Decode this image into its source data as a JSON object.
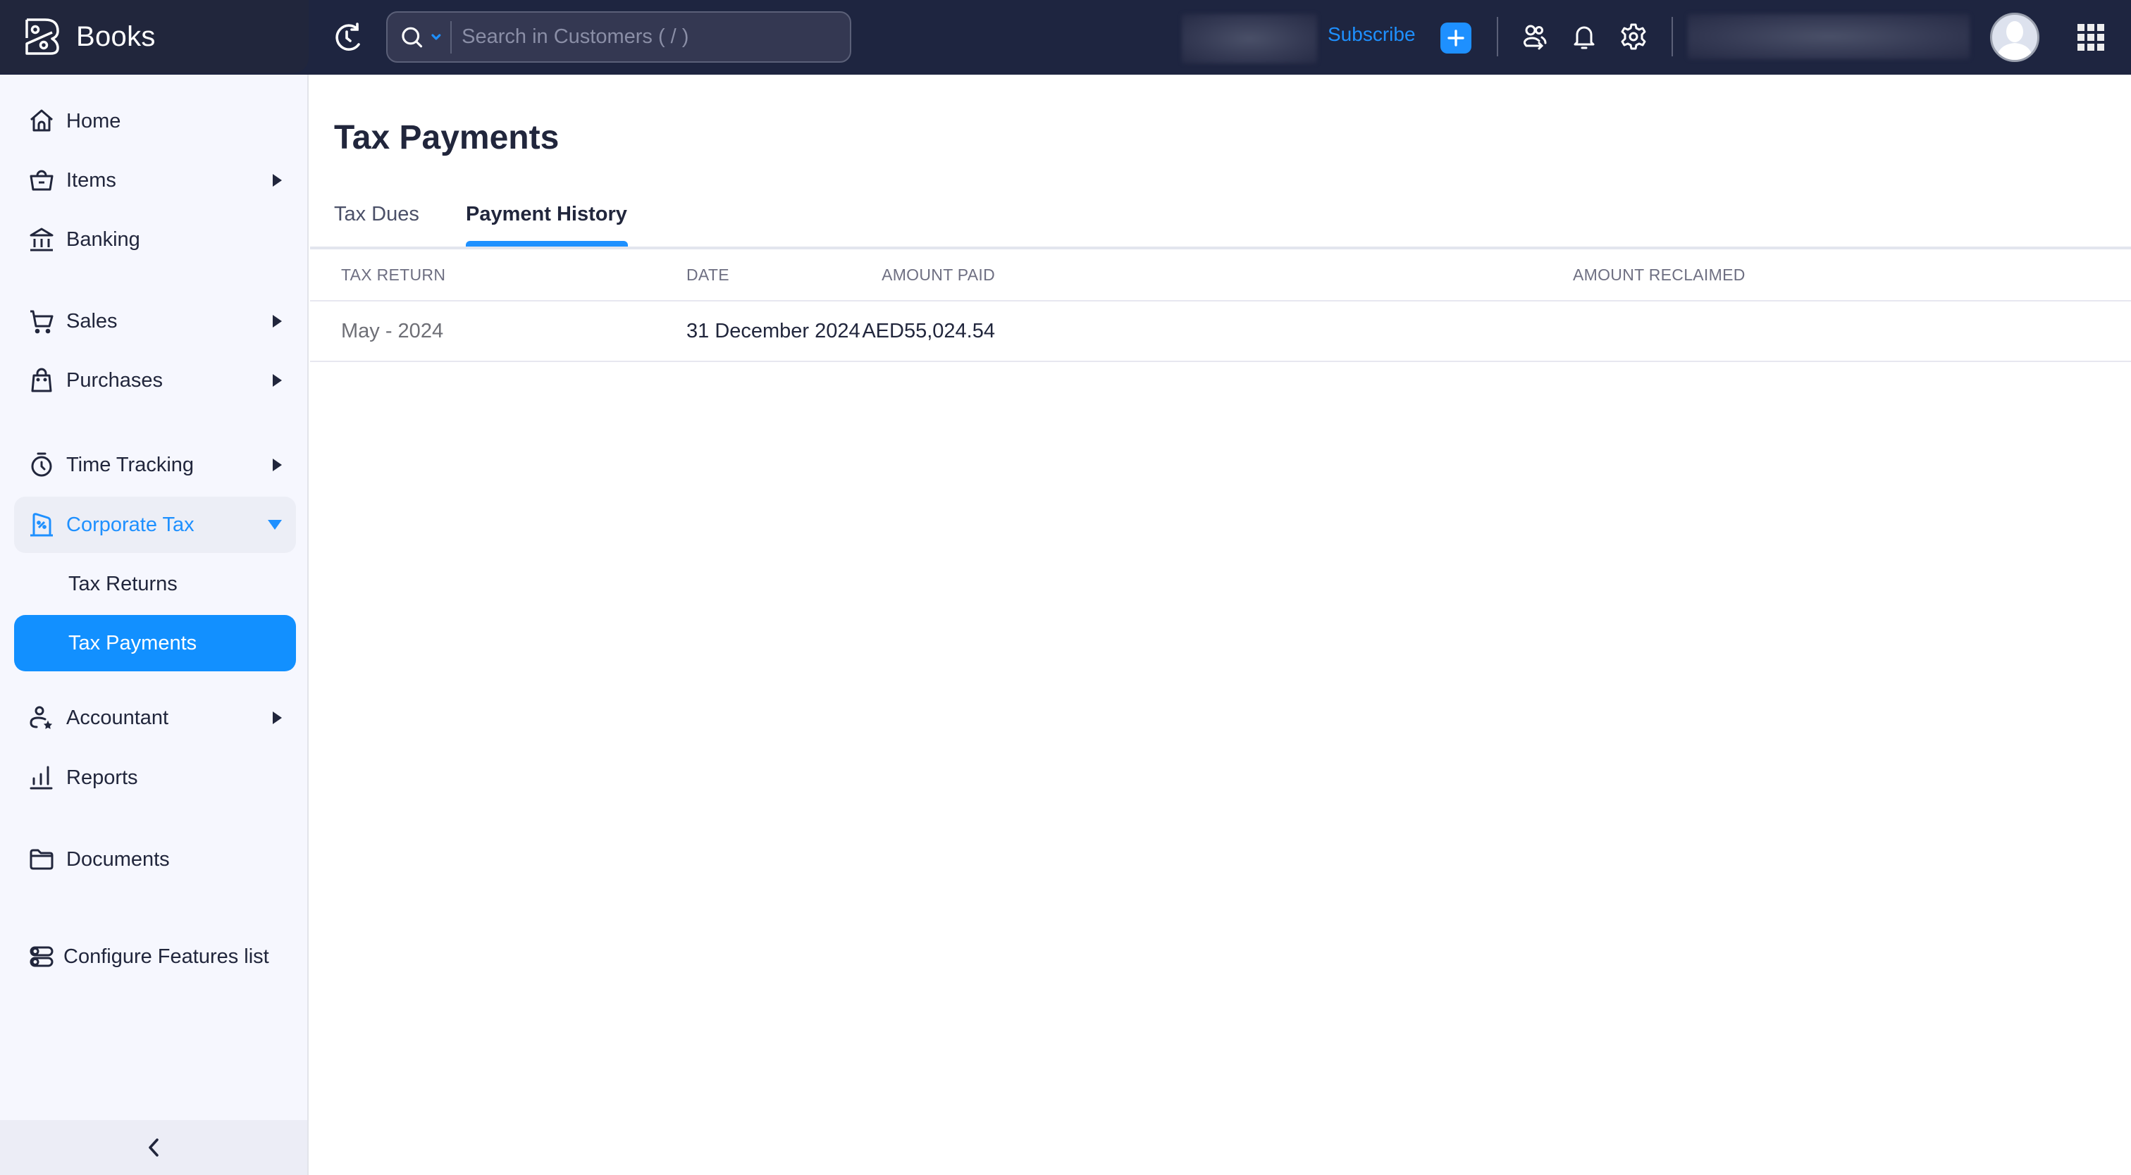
{
  "app": {
    "name": "Books",
    "logo_icon": "books-logo-icon"
  },
  "topbar": {
    "recent_icon": "history-clock-icon",
    "search": {
      "icon": "search-icon",
      "placeholder": "Search in Customers ( / )",
      "value": ""
    },
    "subscribe_label": "Subscribe",
    "add_icon": "plus-icon",
    "icons": [
      "refer-users-icon",
      "bell-icon",
      "gear-icon"
    ],
    "apps_icon": "apps-grid-icon"
  },
  "sidebar": {
    "items": [
      {
        "label": "Home",
        "icon": "home-icon",
        "has_submenu": false
      },
      {
        "label": "Items",
        "icon": "basket-icon",
        "has_submenu": true
      },
      {
        "label": "Banking",
        "icon": "bank-icon",
        "has_submenu": false
      },
      {
        "label": "Sales",
        "icon": "cart-icon",
        "has_submenu": true
      },
      {
        "label": "Purchases",
        "icon": "shopping-bag-icon",
        "has_submenu": true
      },
      {
        "label": "Time Tracking",
        "icon": "stopwatch-icon",
        "has_submenu": true
      },
      {
        "label": "Corporate Tax",
        "icon": "tax-document-icon",
        "has_submenu": true,
        "expanded": true
      },
      {
        "label": "Accountant",
        "icon": "accountant-icon",
        "has_submenu": true
      },
      {
        "label": "Reports",
        "icon": "bar-chart-icon",
        "has_submenu": false
      },
      {
        "label": "Documents",
        "icon": "folder-icon",
        "has_submenu": false
      },
      {
        "label": "Configure Features list",
        "icon": "toggles-icon",
        "has_submenu": false
      }
    ],
    "corporate_tax_subitems": [
      {
        "label": "Tax Returns",
        "active": false
      },
      {
        "label": "Tax Payments",
        "active": true
      }
    ],
    "collapse_icon": "chevron-left-icon"
  },
  "main": {
    "title": "Tax Payments",
    "tabs": [
      {
        "label": "Tax Dues",
        "active": false
      },
      {
        "label": "Payment History",
        "active": true
      }
    ],
    "table": {
      "columns": [
        "TAX RETURN",
        "DATE",
        "AMOUNT PAID",
        "AMOUNT RECLAIMED"
      ],
      "rows": [
        {
          "tax_return": "May - 2024",
          "date": "31 December 2024",
          "amount_paid": "AED55,024.54",
          "amount_reclaimed": ""
        }
      ]
    }
  },
  "colors": {
    "accent": "#1e90ff",
    "topbar_bg": "#1e2540",
    "sidebar_bg": "#f6f7fe",
    "text_primary": "#21263c"
  }
}
